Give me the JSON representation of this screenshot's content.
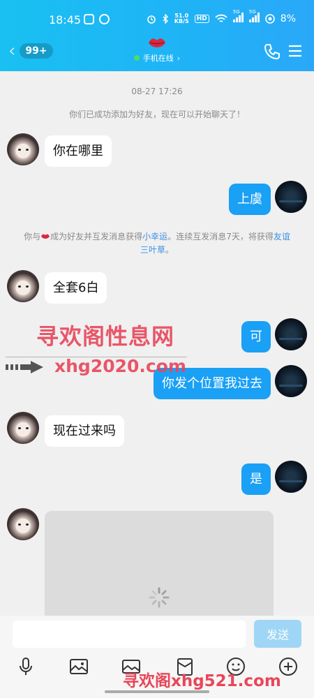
{
  "status_bar": {
    "time": "18:45",
    "speed_value": "51.0",
    "speed_unit": "KB/S",
    "hd_label": "HD",
    "network_1": "5G",
    "network_2": "5G",
    "battery": "8%"
  },
  "header": {
    "unread_count": "99+",
    "online_status": "手机在线",
    "online_chevron": "›"
  },
  "chat": {
    "timestamp": "08-27 17:26",
    "added_notice": "你们已成功添加为好友，现在可以开始聊天了！",
    "system_message": {
      "prefix": "你与",
      "middle": "成为好友并互发消息获得",
      "link_1": "小幸运",
      "suffix_1": "。连续互发消息7天，将获得",
      "link_2": "友谊三叶草",
      "suffix_2": "。"
    },
    "messages": [
      {
        "side": "in",
        "text": "你在哪里"
      },
      {
        "side": "out",
        "text": "上虞"
      },
      {
        "side": "in",
        "text": "全套6白"
      },
      {
        "side": "out",
        "text": "可"
      },
      {
        "side": "out",
        "text": "你发个位置我过去"
      },
      {
        "side": "in",
        "text": "现在过来吗"
      },
      {
        "side": "out",
        "text": "是"
      }
    ]
  },
  "watermarks": {
    "line_1": "寻欢阁性息网",
    "line_2": "xhg2020.com",
    "line_3": "寻欢阁xhg521.com"
  },
  "input": {
    "value": "",
    "send_label": "发送"
  },
  "colors": {
    "accent": "#1aa0f5",
    "header_start": "#1ac0f2",
    "send_disabled": "#9fd6f6",
    "watermark": "#e8465a"
  }
}
